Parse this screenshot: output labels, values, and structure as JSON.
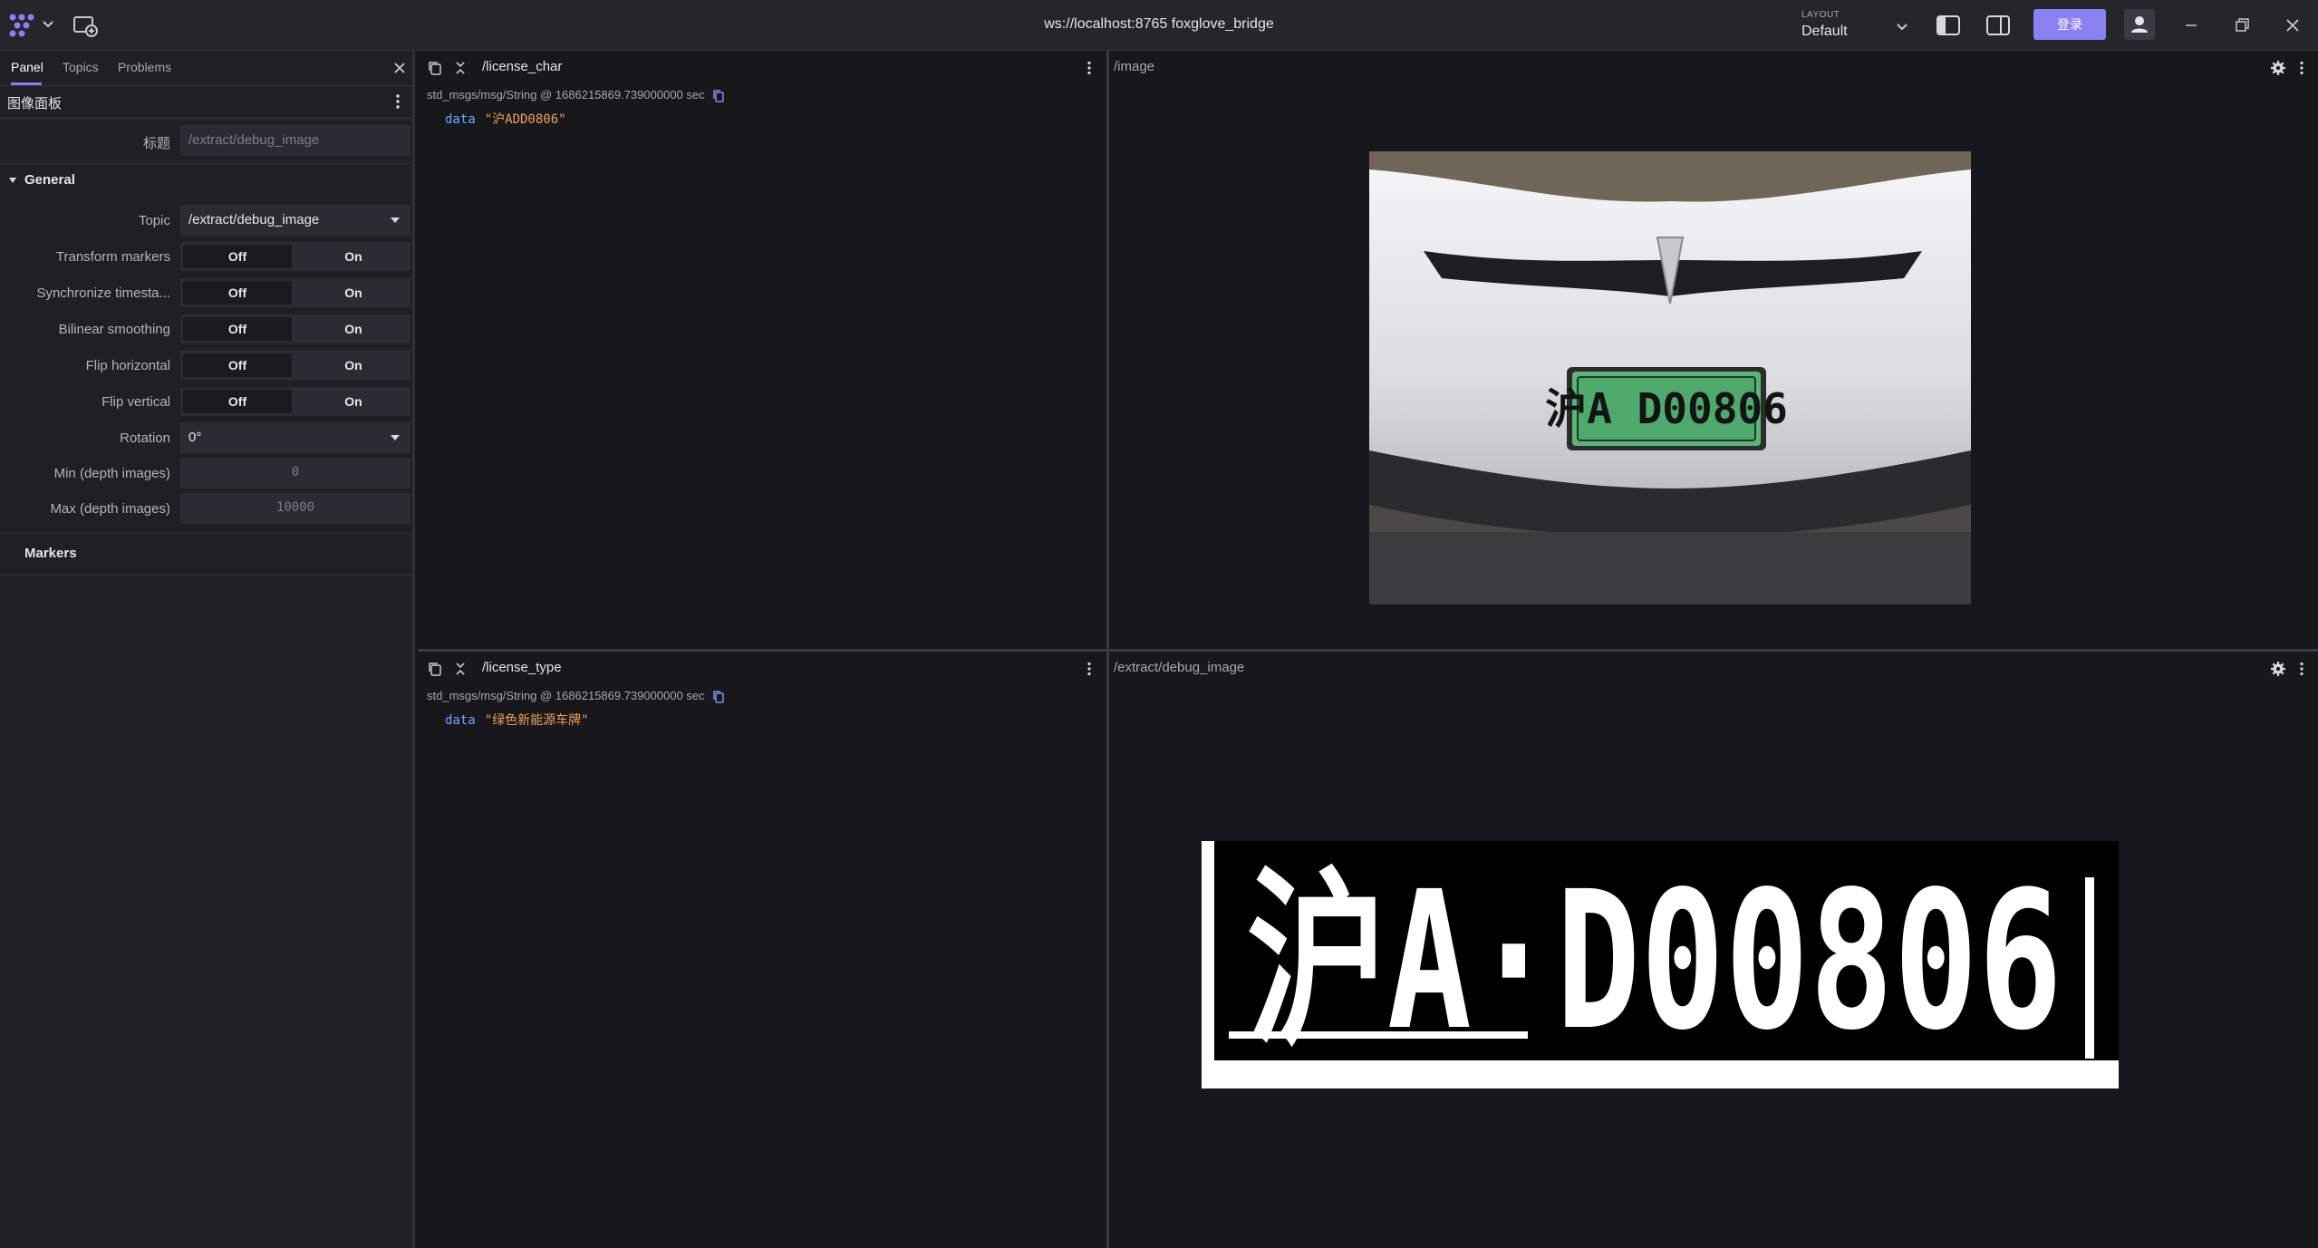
{
  "app": {
    "title": "ws://localhost:8765 foxglove_bridge",
    "layout_label": "LAYOUT",
    "layout_value": "Default",
    "sign_in_label": "登录",
    "accent_color": "#8c7ff0"
  },
  "sidebar": {
    "tabs": [
      {
        "label": "Panel",
        "active": true
      },
      {
        "label": "Topics",
        "active": false
      },
      {
        "label": "Problems",
        "active": false
      }
    ],
    "panel_title": "图像面板",
    "title_field": {
      "label": "标题",
      "placeholder": "/extract/debug_image"
    },
    "general_section": "General",
    "fields": {
      "topic": {
        "label": "Topic",
        "value": "/extract/debug_image"
      },
      "transform_markers": {
        "label": "Transform markers",
        "off": "Off",
        "on": "On"
      },
      "sync_timestamps": {
        "label": "Synchronize timesta...",
        "off": "Off",
        "on": "On"
      },
      "bilinear_smoothing": {
        "label": "Bilinear smoothing",
        "off": "Off",
        "on": "On"
      },
      "flip_horizontal": {
        "label": "Flip horizontal",
        "off": "Off",
        "on": "On"
      },
      "flip_vertical": {
        "label": "Flip vertical",
        "off": "Off",
        "on": "On"
      },
      "rotation": {
        "label": "Rotation",
        "value": "0°"
      },
      "min_depth": {
        "label": "Min (depth images)",
        "placeholder": "0"
      },
      "max_depth": {
        "label": "Max (depth images)",
        "placeholder": "10000"
      }
    },
    "markers_section": "Markers"
  },
  "panels": {
    "license_char": {
      "topic": "/license_char",
      "meta": "std_msgs/msg/String @ 1686215869.739000000 sec",
      "key": "data",
      "value": "\"沪ADD0806\""
    },
    "license_type": {
      "topic": "/license_type",
      "meta": "std_msgs/msg/String @ 1686215869.739000000 sec",
      "key": "data",
      "value": "\"绿色新能源车牌\""
    },
    "image": {
      "topic": "/image",
      "plate_text": "沪A D00806"
    },
    "debug_image": {
      "topic": "/extract/debug_image",
      "plate_text": "沪A·D00806"
    }
  },
  "icons": [
    "app-logo-icon",
    "chevron-down-icon",
    "add-panel-icon",
    "left-sidebar-icon",
    "right-sidebar-icon",
    "user-icon",
    "minimize-icon",
    "restore-icon",
    "close-icon",
    "kebab-menu-icon",
    "copy-icon",
    "collapse-icon",
    "gear-icon",
    "dropdown-caret-icon"
  ]
}
